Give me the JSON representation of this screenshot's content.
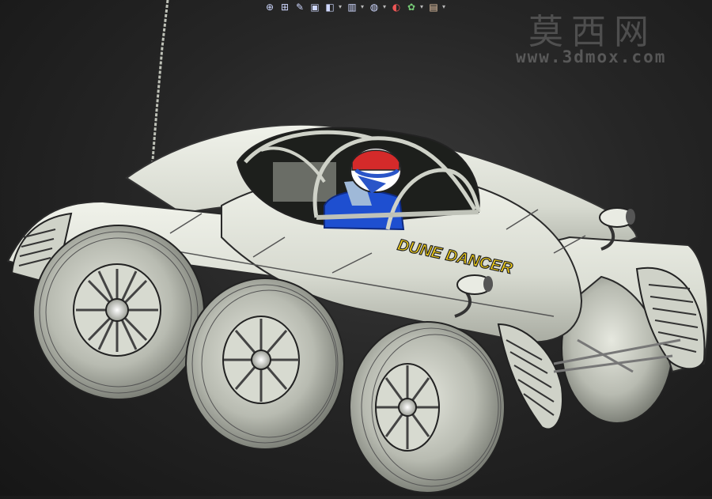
{
  "toolbar": {
    "items": [
      {
        "name": "zoom-to-fit-icon",
        "glyph": "⊕"
      },
      {
        "name": "zoom-to-area-icon",
        "glyph": "⊞"
      },
      {
        "name": "sketch-icon",
        "glyph": "✎"
      },
      {
        "name": "previous-view-icon",
        "glyph": "▣"
      },
      {
        "name": "section-view-icon",
        "glyph": "◧"
      },
      {
        "name": "view-orientation-icon",
        "glyph": "▥"
      },
      {
        "name": "display-style-icon",
        "glyph": "◍"
      },
      {
        "name": "hide-show-icon",
        "glyph": "◐"
      },
      {
        "name": "edit-appearance-icon",
        "glyph": "✿"
      },
      {
        "name": "apply-scene-icon",
        "glyph": "▤"
      }
    ],
    "colors": {
      "icon": "#cfd8ff",
      "accent_red": "#d33",
      "accent_blue": "#36c"
    }
  },
  "watermark": {
    "chinese": "莫西网",
    "url": "www.3dmox.com"
  },
  "vehicle": {
    "decal_text": "DUNE DANCER",
    "decal_color": "#f5d218",
    "body_color": "#d9dcd2",
    "helmet_colors": [
      "#d42a2a",
      "#2a55c8",
      "#ffffff"
    ],
    "suit_color": "#1e4fd0"
  }
}
